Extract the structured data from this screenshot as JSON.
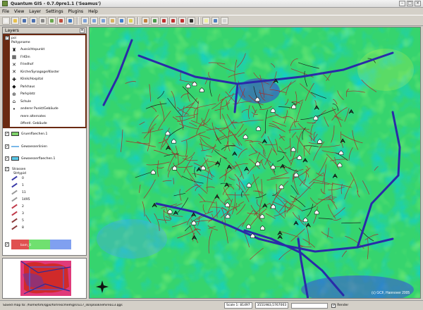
{
  "window": {
    "title": "Quantum GIS - 0.7.0pre1.1 ('Seamus')"
  },
  "menu": [
    "File",
    "View",
    "Layer",
    "Settings",
    "Plugins",
    "Help"
  ],
  "toolbar": {
    "buttons": [
      {
        "name": "new-project-icon",
        "color": "#f2f2f2"
      },
      {
        "name": "open-project-icon",
        "color": "#e8c14a"
      },
      {
        "name": "save-icon",
        "color": "#4a6fb0"
      },
      {
        "name": "save-as-icon",
        "color": "#4a6fb0"
      },
      {
        "name": "print-icon",
        "color": "#888888"
      },
      {
        "name": "add-raster-icon",
        "color": "#6aa84f"
      },
      {
        "name": "add-vector-icon",
        "color": "#c04a3a"
      },
      {
        "name": "add-postgis-icon",
        "color": "#3b78c4"
      },
      {
        "name": "zoom-in-icon",
        "color": "#7aa0d8"
      },
      {
        "name": "zoom-out-icon",
        "color": "#7aa0d8"
      },
      {
        "name": "zoom-full-icon",
        "color": "#7aa0d8"
      },
      {
        "name": "pan-icon",
        "color": "#d8b060"
      },
      {
        "name": "identify-icon",
        "color": "#3f7fd0"
      },
      {
        "name": "select-icon",
        "color": "#e0d050"
      },
      {
        "name": "measure-icon",
        "color": "#c08040"
      },
      {
        "name": "refresh-icon",
        "color": "#4a9a4a"
      },
      {
        "name": "capture-point-icon",
        "color": "#c03030"
      },
      {
        "name": "capture-line-icon",
        "color": "#c03030"
      },
      {
        "name": "capture-polygon-icon",
        "color": "#c03030"
      },
      {
        "name": "delete-icon",
        "color": "#303030"
      },
      {
        "name": "map-tips-icon",
        "color": "#f0f0a0"
      },
      {
        "name": "bookmark-icon",
        "color": "#5080c0"
      },
      {
        "name": "help-icon",
        "color": "#d0d0d0"
      }
    ]
  },
  "layers_panel": {
    "title": "Layers",
    "poi_layer": {
      "name": "poi",
      "field": "Poitypname",
      "items": [
        {
          "label": "Aussichtspunkt",
          "icon": "viewpoint-icon",
          "glyph": "♜"
        },
        {
          "label": "FHÜm",
          "icon": "building-icon",
          "glyph": "▦"
        },
        {
          "label": "Friedhof",
          "icon": "cemetery-cross-icon",
          "glyph": "✕"
        },
        {
          "label": "Kirche/Synagoge/Kloster",
          "icon": "church-icon",
          "glyph": "✕"
        },
        {
          "label": "Klinik/Hospital",
          "icon": "hospital-icon",
          "glyph": "✚"
        },
        {
          "label": "Parkhaus",
          "icon": "parking-garage-icon",
          "glyph": "◆"
        },
        {
          "label": "Parkplatz",
          "icon": "parking-icon",
          "glyph": "⊕"
        },
        {
          "label": "Schule",
          "icon": "school-icon",
          "glyph": "⌂"
        },
        {
          "label": "anderer Punkt/Gebäude",
          "icon": "other-point-icon",
          "glyph": "•"
        },
        {
          "label": "mere alternates",
          "icon": "blank-icon",
          "glyph": ""
        },
        {
          "label": "öffentl. Gebäude",
          "icon": "blank-icon",
          "glyph": ""
        }
      ]
    },
    "layers": [
      {
        "label": "Gruenflaechen.1",
        "color": "#7fd36a"
      },
      {
        "label": "Gewaesserlinien",
        "color": "#7ab8e8"
      },
      {
        "label": "Gewaesserflaechen.1",
        "color": "#5ac8e8"
      }
    ],
    "streets_layer": {
      "name": "Strassen",
      "field": "Strtypid",
      "items": [
        {
          "label": "0",
          "color": "#3a3aa8"
        },
        {
          "label": "1",
          "color": "#3a3aa8"
        },
        {
          "label": "11",
          "color": "#9a9a9a"
        },
        {
          "label": "1495",
          "color": "#9a9a9a"
        },
        {
          "label": "2",
          "color": "#c03a4a"
        },
        {
          "label": "3",
          "color": "#c03a4a"
        },
        {
          "label": "5",
          "color": "#8a3a3a"
        },
        {
          "label": "8",
          "color": "#8a3a3a"
        }
      ]
    },
    "raster_layer": {
      "label": "bam_0",
      "colors": [
        "#e05050",
        "#70e070",
        "#80a0f0"
      ]
    }
  },
  "map": {
    "copyright": "(c) GCF, Hannover 2005"
  },
  "status": {
    "message": "Saved map to: /home/tim/qgis/forlrescmemg/sru17_sknplooknehirea13.qgs",
    "scale": "Scale 1: 81497",
    "coords": "3551983,5767003",
    "render_label": "Render",
    "render_checked": true
  },
  "colors": {
    "accent_brown": "#6a2a12",
    "map_green": "#2fd36a",
    "street_red": "#a82a2a",
    "highway_blue": "#2a2aa8"
  }
}
